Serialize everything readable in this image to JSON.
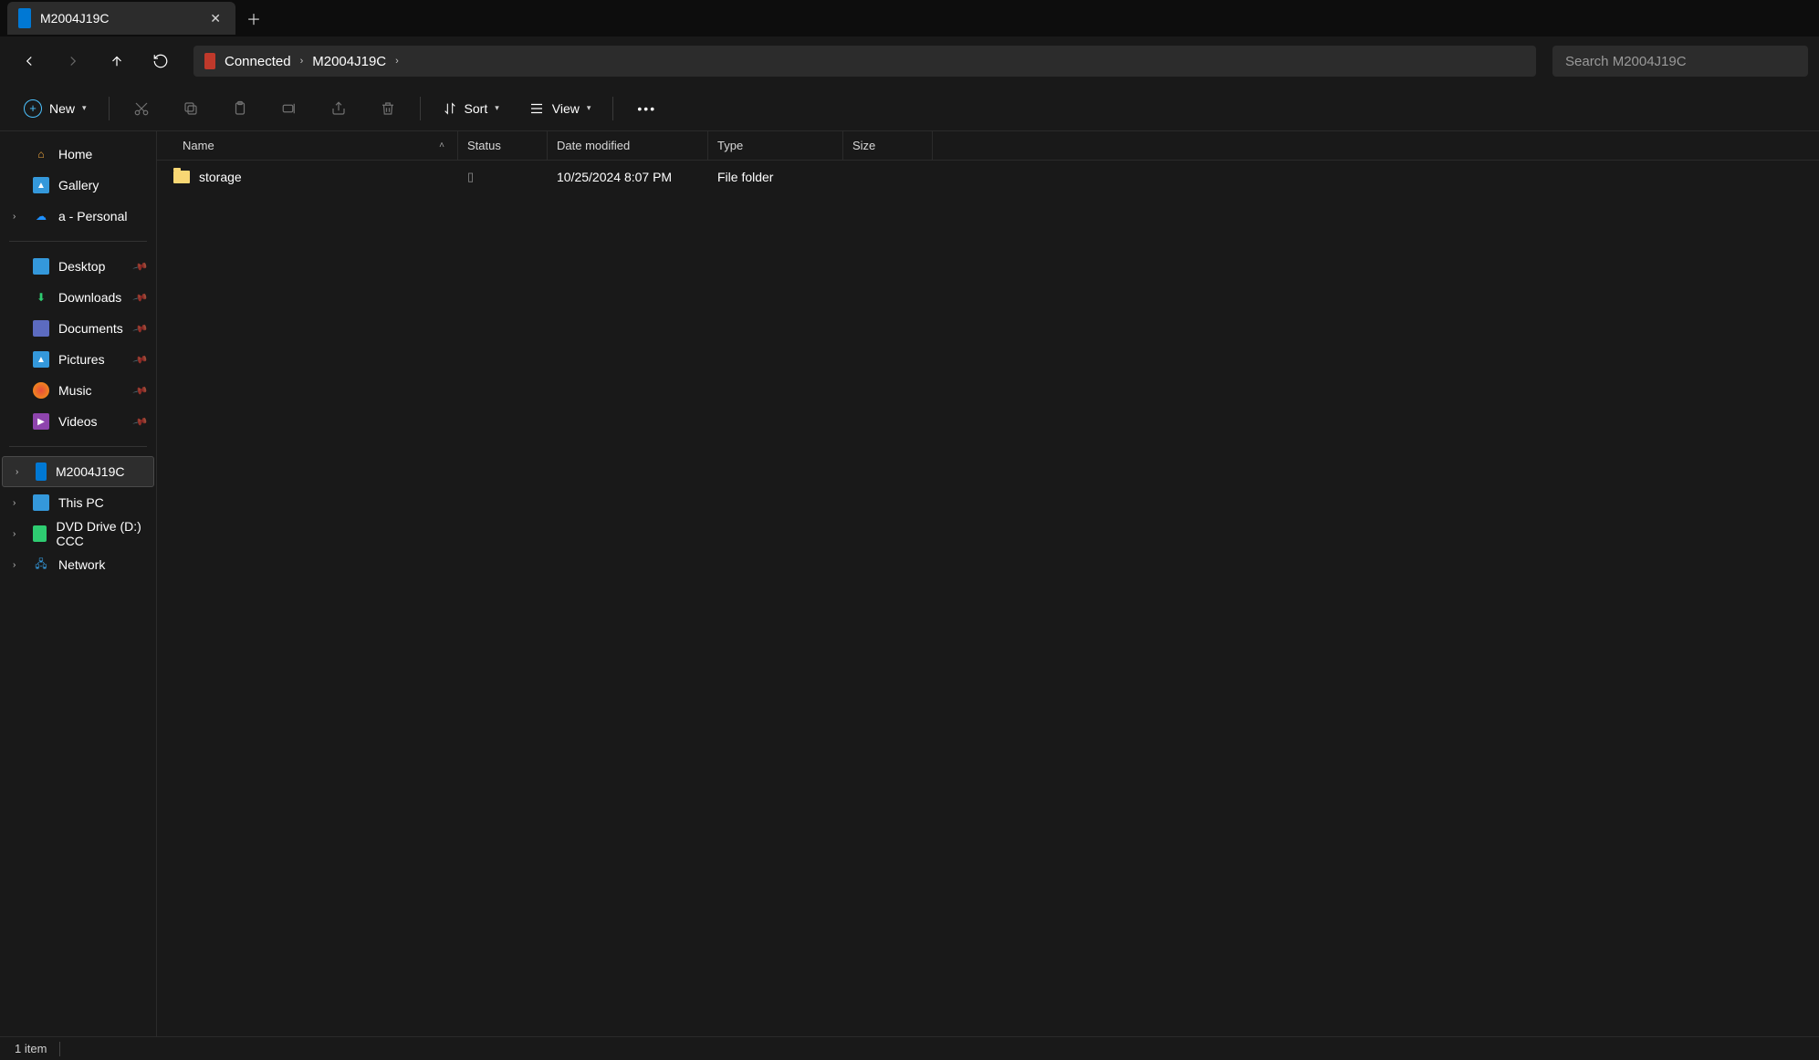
{
  "tab": {
    "title": "M2004J19C"
  },
  "breadcrumb": {
    "root_label": "Connected",
    "device_label": "M2004J19C"
  },
  "search": {
    "placeholder": "Search M2004J19C"
  },
  "toolbar": {
    "new_label": "New",
    "sort_label": "Sort",
    "view_label": "View"
  },
  "sidebar": {
    "home": "Home",
    "gallery": "Gallery",
    "personal": "a - Personal",
    "desktop": "Desktop",
    "downloads": "Downloads",
    "documents": "Documents",
    "pictures": "Pictures",
    "music": "Music",
    "videos": "Videos",
    "device": "M2004J19C",
    "this_pc": "This PC",
    "dvd": "DVD Drive (D:) CCC",
    "network": "Network"
  },
  "columns": {
    "name": "Name",
    "status": "Status",
    "date": "Date modified",
    "type": "Type",
    "size": "Size"
  },
  "rows": [
    {
      "name": "storage",
      "date": "10/25/2024 8:07 PM",
      "type": "File folder"
    }
  ],
  "status_bar": {
    "item_count": "1 item"
  }
}
